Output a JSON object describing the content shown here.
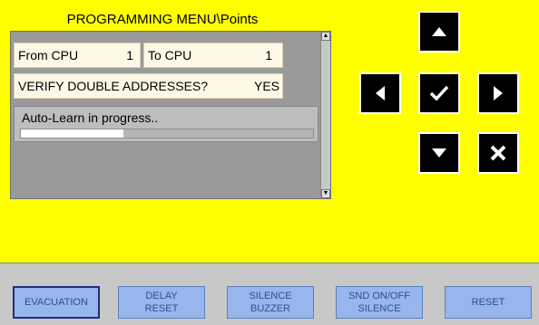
{
  "header": {
    "title": "PROGRAMMING MENU\\Points"
  },
  "rows": {
    "from_cpu_label": "From CPU",
    "from_cpu_value": "1",
    "to_cpu_label": "To CPU",
    "to_cpu_value": "1",
    "verify_label": "VERIFY DOUBLE ADDRESSES?",
    "verify_value": "YES"
  },
  "status": {
    "text": "Auto-Learn in progress..",
    "progress_percent": 35
  },
  "nav": {
    "up_icon": "arrow-up-icon",
    "left_icon": "arrow-left-icon",
    "confirm_icon": "checkmark-icon",
    "right_icon": "arrow-right-icon",
    "down_icon": "arrow-down-icon",
    "cancel_icon": "cross-icon"
  },
  "footer": {
    "evacuation": "EVACUATION",
    "delay_reset": "DELAY\nRESET",
    "silence_buzzer": "SILENCE\nBUZZER",
    "snd_silence": "SND ON/OFF\nSILENCE",
    "reset": "RESET"
  },
  "colors": {
    "background": "#ffff00",
    "panel": "#9a9a9a",
    "button": "#97b6ee"
  }
}
